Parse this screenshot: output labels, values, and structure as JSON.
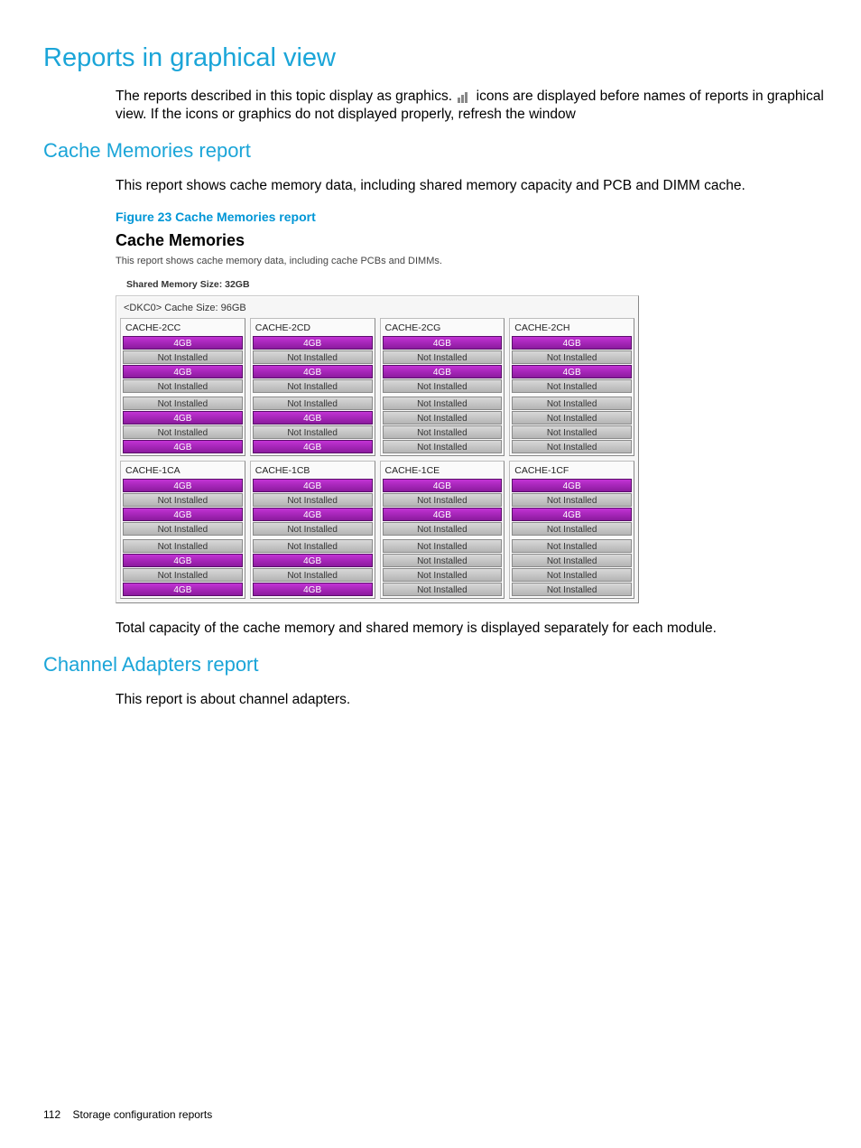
{
  "headings": {
    "h1": "Reports in graphical view",
    "h2_cache": "Cache Memories report",
    "h2_channel": "Channel Adapters report"
  },
  "paragraphs": {
    "p1a": "The reports described in this topic display as graphics. ",
    "p1b": " icons are displayed before names of reports in graphical view. If the icons or graphics do not displayed properly, refresh the window",
    "p2": "This report shows cache memory data, including shared memory capacity and PCB and DIMM cache.",
    "figure_label": "Figure 23 Cache Memories report",
    "p3": "Total capacity of the cache memory and shared memory is displayed separately for each module.",
    "p4": "This report is about channel adapters."
  },
  "panel": {
    "title": "Cache Memories",
    "desc": "This report shows cache memory data, including cache PCBs and DIMMs.",
    "shared_mem": "Shared Memory Size: 32GB",
    "dkc_title": "<DKC0> Cache Size: 96GB"
  },
  "strings": {
    "filled": "4GB",
    "empty": "Not Installed"
  },
  "rows": [
    [
      {
        "label": "CACHE-2CC",
        "groups": [
          [
            1,
            0,
            1,
            0
          ],
          [
            0,
            1,
            0,
            1
          ]
        ]
      },
      {
        "label": "CACHE-2CD",
        "groups": [
          [
            1,
            0,
            1,
            0
          ],
          [
            0,
            1,
            0,
            1
          ]
        ]
      },
      {
        "label": "CACHE-2CG",
        "groups": [
          [
            1,
            0,
            1,
            0
          ],
          [
            0,
            0,
            0,
            0
          ]
        ]
      },
      {
        "label": "CACHE-2CH",
        "groups": [
          [
            1,
            0,
            1,
            0
          ],
          [
            0,
            0,
            0,
            0
          ]
        ]
      }
    ],
    [
      {
        "label": "CACHE-1CA",
        "groups": [
          [
            1,
            0,
            1,
            0
          ],
          [
            0,
            1,
            0,
            1
          ]
        ]
      },
      {
        "label": "CACHE-1CB",
        "groups": [
          [
            1,
            0,
            1,
            0
          ],
          [
            0,
            1,
            0,
            1
          ]
        ]
      },
      {
        "label": "CACHE-1CE",
        "groups": [
          [
            1,
            0,
            1,
            0
          ],
          [
            0,
            0,
            0,
            0
          ]
        ]
      },
      {
        "label": "CACHE-1CF",
        "groups": [
          [
            1,
            0,
            1,
            0
          ],
          [
            0,
            0,
            0,
            0
          ]
        ]
      }
    ]
  ],
  "footer": {
    "page": "112",
    "section": "Storage configuration reports"
  }
}
